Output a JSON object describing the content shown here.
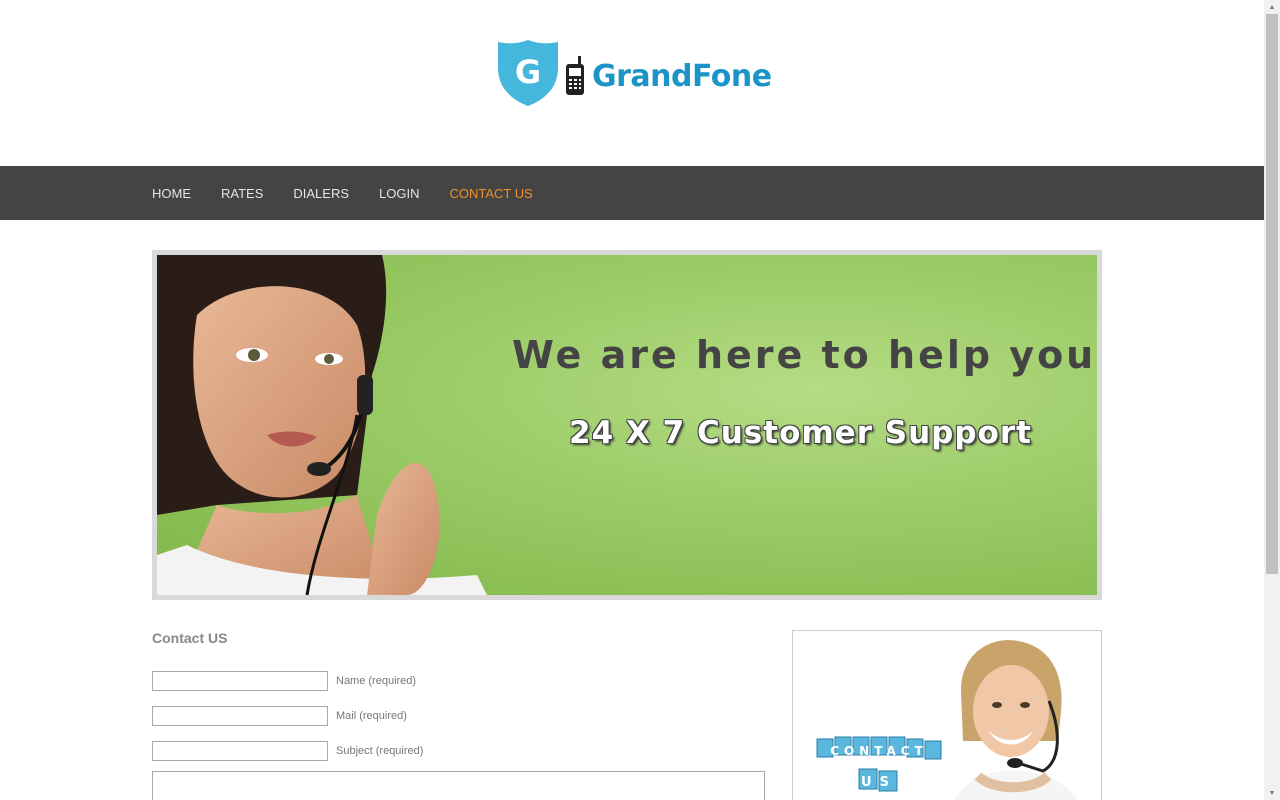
{
  "brand": {
    "logo_letter": "G",
    "name": "GrandFone",
    "color": "#1b95c7"
  },
  "nav": {
    "items": [
      "HOME",
      "RATES",
      "DIALERS",
      "LOGIN",
      "CONTACT US"
    ],
    "active": "CONTACT US",
    "active_color": "#f0902a"
  },
  "banner": {
    "headline": "We are here to help you",
    "subline": "24 X 7 Customer Support"
  },
  "contact": {
    "title": "Contact US",
    "fields": [
      {
        "label": "Name (required)",
        "value": ""
      },
      {
        "label": "Mail (required)",
        "value": ""
      },
      {
        "label": "Subject (required)",
        "value": ""
      }
    ],
    "message_value": ""
  },
  "side": {
    "cubes_line1": "CONTACT",
    "cubes_line2": "US"
  },
  "icons": [
    "shield-icon",
    "mobile-phone-icon"
  ]
}
